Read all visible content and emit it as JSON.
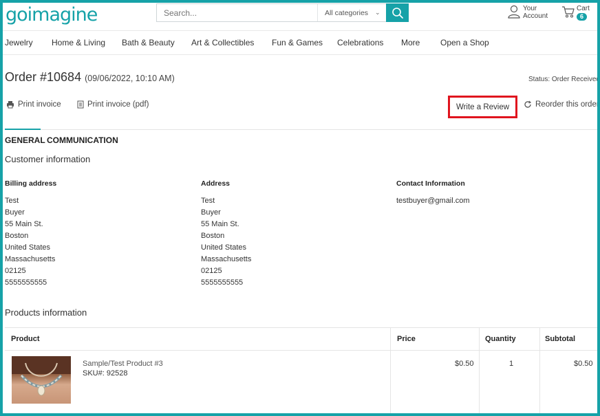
{
  "header": {
    "logo": {
      "prefix": "go",
      "mid": "im",
      "suffix": "agine"
    },
    "search": {
      "placeholder": "Search...",
      "category": "All categories"
    },
    "account": {
      "line1": "Your",
      "line2": "Account"
    },
    "cart": {
      "label": "Cart",
      "count": "6"
    }
  },
  "nav": {
    "items": [
      "Jewelry",
      "Home & Living",
      "Bath & Beauty",
      "Art & Collectibles",
      "Fun & Games",
      "Celebrations",
      "More",
      "Open a Shop"
    ]
  },
  "order": {
    "title": "Order #10684",
    "date": "(09/06/2022, 10:10 AM)",
    "status": "Status: Order Received",
    "actions": {
      "print_invoice": "Print invoice",
      "print_invoice_pdf": "Print invoice (pdf)",
      "write_review": "Write a Review",
      "reorder": "Reorder this order"
    }
  },
  "tabs": [
    "GENERAL",
    "COMMUNICATION"
  ],
  "customer": {
    "title": "Customer information",
    "billing": {
      "heading": "Billing address",
      "lines": [
        "Test",
        "Buyer",
        "55 Main St.",
        "Boston",
        "United States",
        "Massachusetts",
        "02125",
        "5555555555"
      ]
    },
    "address": {
      "heading": "Address",
      "lines": [
        "Test",
        "Buyer",
        "55 Main St.",
        "Boston",
        "United States",
        "Massachusetts",
        "02125",
        "5555555555"
      ]
    },
    "contact": {
      "heading": "Contact Information",
      "email": "testbuyer@gmail.com"
    }
  },
  "products": {
    "title": "Products information",
    "columns": [
      "Product",
      "Price",
      "Quantity",
      "Subtotal"
    ],
    "rows": [
      {
        "name": "Sample/Test Product #3",
        "sku": "SKU#: 92528",
        "price": "$0.50",
        "quantity": "1",
        "subtotal": "$0.50"
      }
    ]
  },
  "colors": {
    "accent": "#16a2a8",
    "highlight": "#e0141e"
  }
}
